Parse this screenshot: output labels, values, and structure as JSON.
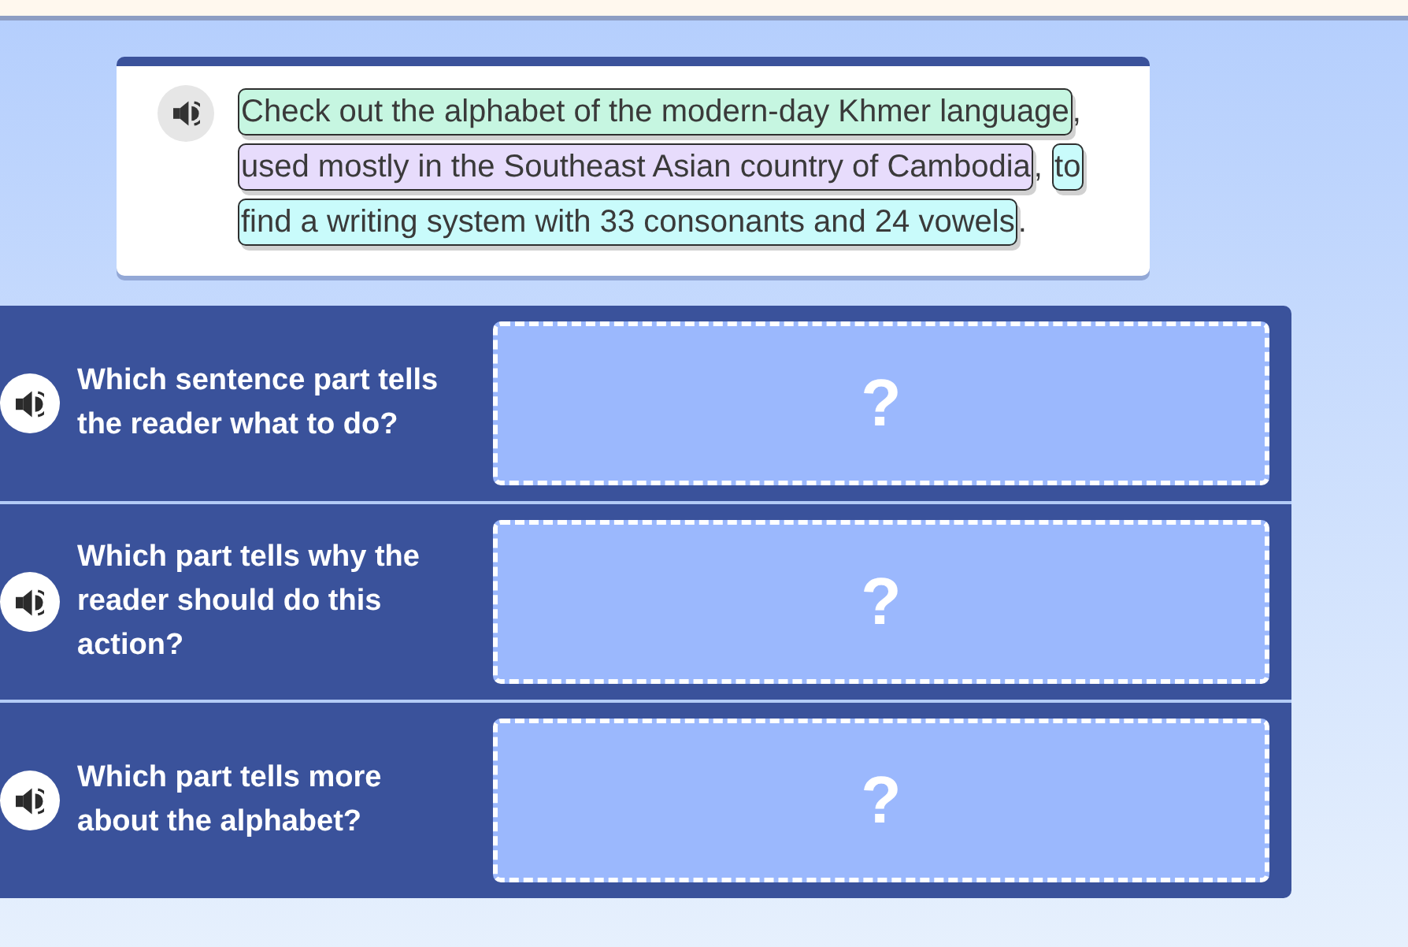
{
  "passage": {
    "segments": [
      {
        "kind": "highlight",
        "lines": [
          "Check out the alphabet of the modern-day Khmer language"
        ],
        "color": "#c6f6e1"
      },
      {
        "kind": "plain",
        "text": ","
      },
      {
        "kind": "highlight",
        "lines": [
          "used mostly in the Southeast Asian country of Cambodia"
        ],
        "color": "#e7dcfc"
      },
      {
        "kind": "plain",
        "text": ","
      },
      {
        "kind": "highlight",
        "lines": [
          "to",
          "find a writing system with 33 consonants and 24 vowels"
        ],
        "color": "#c9fbfb"
      },
      {
        "kind": "plain",
        "text": "."
      }
    ]
  },
  "questions": [
    {
      "text": "Which sentence part tells the reader what to do?",
      "answer_text": "?"
    },
    {
      "text": "Which part tells why the reader should do this action?",
      "answer_text": "?"
    },
    {
      "text": "Which part tells more about the alphabet?",
      "answer_text": "?"
    }
  ]
}
